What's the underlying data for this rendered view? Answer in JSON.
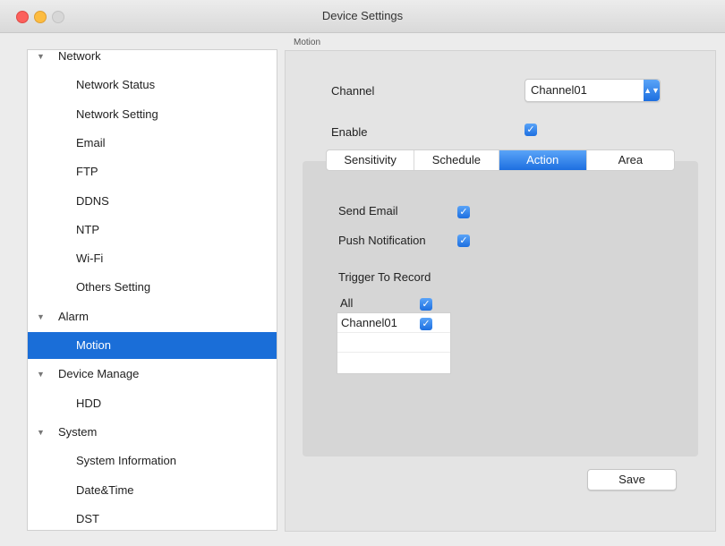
{
  "window": {
    "title": "Device Settings"
  },
  "sidebar": {
    "items": [
      {
        "label": "Network",
        "level": 0,
        "expanded": true
      },
      {
        "label": "Network Status",
        "level": 1
      },
      {
        "label": "Network Setting",
        "level": 1
      },
      {
        "label": "Email",
        "level": 1
      },
      {
        "label": "FTP",
        "level": 1
      },
      {
        "label": "DDNS",
        "level": 1
      },
      {
        "label": "NTP",
        "level": 1
      },
      {
        "label": "Wi-Fi",
        "level": 1
      },
      {
        "label": "Others Setting",
        "level": 1
      },
      {
        "label": "Alarm",
        "level": 0,
        "expanded": true
      },
      {
        "label": "Motion",
        "level": 1,
        "selected": true
      },
      {
        "label": "Device Manage",
        "level": 0,
        "expanded": true
      },
      {
        "label": "HDD",
        "level": 1
      },
      {
        "label": "System",
        "level": 0,
        "expanded": true
      },
      {
        "label": "System Information",
        "level": 1
      },
      {
        "label": "Date&Time",
        "level": 1
      },
      {
        "label": "DST",
        "level": 1
      }
    ]
  },
  "panel": {
    "caption": "Motion",
    "channel_label": "Channel",
    "channel_value": "Channel01",
    "enable_label": "Enable",
    "enable_checked": true,
    "tabs": [
      {
        "label": "Sensitivity",
        "active": false
      },
      {
        "label": "Schedule",
        "active": false
      },
      {
        "label": "Action",
        "active": true
      },
      {
        "label": "Area",
        "active": false
      }
    ],
    "send_email_label": "Send Email",
    "send_email_checked": true,
    "push_notification_label": "Push Notification",
    "push_notification_checked": true,
    "trigger_label": "Trigger To Record",
    "trigger_all_label": "All",
    "trigger_all_checked": true,
    "trigger_channel_label": "Channel01",
    "trigger_channel_checked": true,
    "save_label": "Save"
  },
  "colors": {
    "accent": "#1d6fe0",
    "selection": "#1a6ed8"
  },
  "icons": {
    "collapse": "triangle-down-icon",
    "checkmark": "checkmark-icon",
    "dropdown": "chevron-updown-icon"
  }
}
